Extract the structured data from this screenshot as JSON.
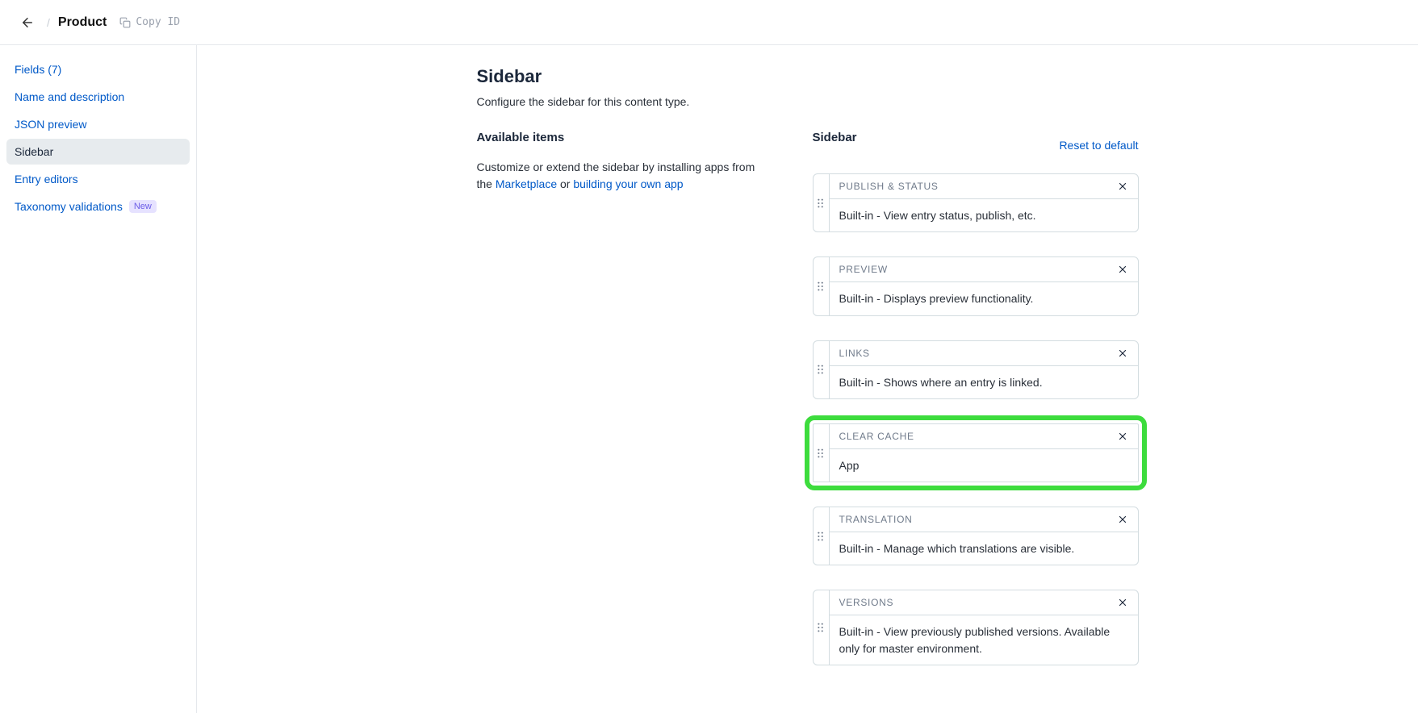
{
  "header": {
    "page_title": "Product",
    "copy_id_label": "Copy ID"
  },
  "nav": {
    "items": [
      {
        "label": "Fields (7)"
      },
      {
        "label": "Name and description"
      },
      {
        "label": "JSON preview"
      },
      {
        "label": "Sidebar",
        "active": true
      },
      {
        "label": "Entry editors"
      },
      {
        "label": "Taxonomy validations",
        "badge": "New"
      }
    ]
  },
  "main": {
    "heading": "Sidebar",
    "subtitle": "Configure the sidebar for this content type.",
    "available_heading": "Available items",
    "available_text": "Customize or extend the sidebar by installing apps from the ",
    "marketplace_link": "Marketplace",
    "or_text": " or ",
    "build_link": "building your own app",
    "sidebar_heading": "Sidebar",
    "reset_label": "Reset to default",
    "widgets": [
      {
        "title": "PUBLISH & STATUS",
        "desc": "Built-in - View entry status, publish, etc."
      },
      {
        "title": "PREVIEW",
        "desc": "Built-in - Displays preview functionality."
      },
      {
        "title": "LINKS",
        "desc": "Built-in - Shows where an entry is linked."
      },
      {
        "title": "CLEAR CACHE",
        "desc": "App",
        "highlighted": true
      },
      {
        "title": "TRANSLATION",
        "desc": "Built-in - Manage which translations are visible."
      },
      {
        "title": "VERSIONS",
        "desc": "Built-in - View previously published versions. Available only for master environment."
      }
    ]
  }
}
